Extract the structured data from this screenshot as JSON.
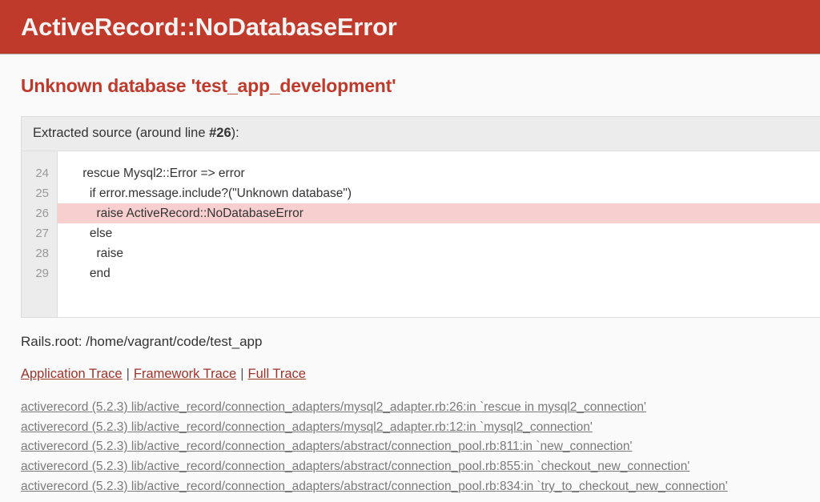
{
  "banner": {
    "title": "ActiveRecord::NoDatabaseError",
    "background": "#bf3a2b",
    "text_color": "#f5f2f2"
  },
  "summary": {
    "text": "Unknown database 'test_app_development'",
    "color": "#bf3a2b"
  },
  "extracted_source": {
    "header_prefix": "Extracted source (around line ",
    "header_line_number": "#26",
    "header_suffix": "):",
    "highlight_color": "#f7cfcf",
    "lines": [
      {
        "number": "24",
        "code": "    rescue Mysql2::Error => error",
        "highlighted": false
      },
      {
        "number": "25",
        "code": "      if error.message.include?(\"Unknown database\")",
        "highlighted": false
      },
      {
        "number": "26",
        "code": "        raise ActiveRecord::NoDatabaseError",
        "highlighted": true
      },
      {
        "number": "27",
        "code": "      else",
        "highlighted": false
      },
      {
        "number": "28",
        "code": "        raise",
        "highlighted": false
      },
      {
        "number": "29",
        "code": "      end",
        "highlighted": false
      }
    ]
  },
  "rails_root": {
    "label": "Rails.root:",
    "path": "/home/vagrant/code/test_app",
    "full": "Rails.root: /home/vagrant/code/test_app"
  },
  "trace_links": {
    "separator": "|",
    "items": [
      {
        "label": "Application Trace"
      },
      {
        "label": "Framework Trace"
      },
      {
        "label": "Full Trace"
      }
    ],
    "link_color": "#9c3328"
  },
  "backtrace": {
    "lines": [
      "activerecord (5.2.3) lib/active_record/connection_adapters/mysql2_adapter.rb:26:in `rescue in mysql2_connection'",
      "activerecord (5.2.3) lib/active_record/connection_adapters/mysql2_adapter.rb:12:in `mysql2_connection'",
      "activerecord (5.2.3) lib/active_record/connection_adapters/abstract/connection_pool.rb:811:in `new_connection'",
      "activerecord (5.2.3) lib/active_record/connection_adapters/abstract/connection_pool.rb:855:in `checkout_new_connection'",
      "activerecord (5.2.3) lib/active_record/connection_adapters/abstract/connection_pool.rb:834:in `try_to_checkout_new_connection'"
    ]
  }
}
